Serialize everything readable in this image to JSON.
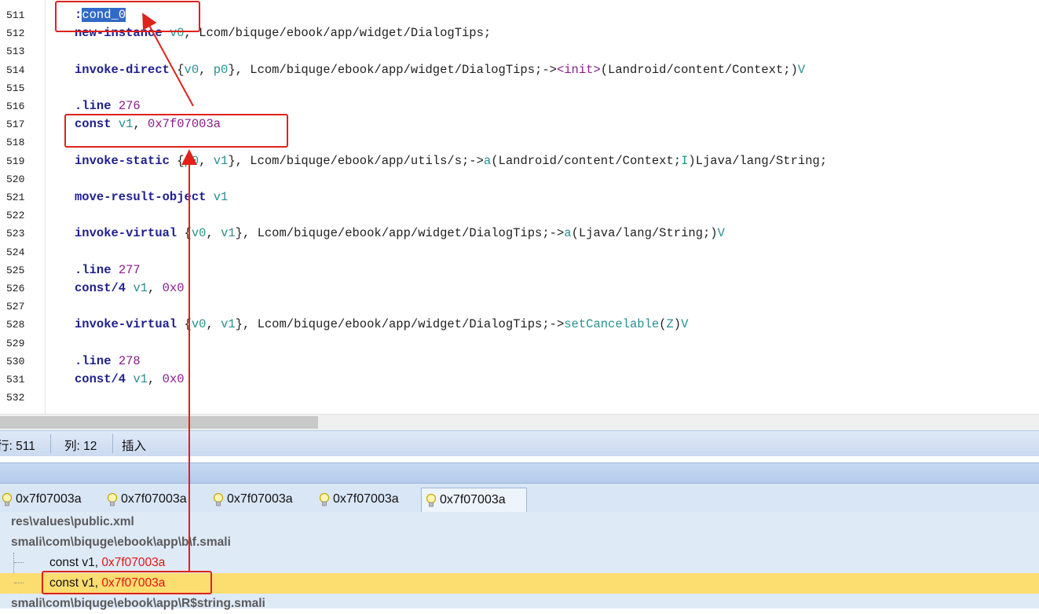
{
  "editor": {
    "lines": [
      {
        "n": "511",
        "label": ":cond_0"
      },
      {
        "n": "512",
        "parts": [
          [
            "kw",
            "new-instance"
          ],
          [
            "tx",
            " "
          ],
          [
            "rg",
            "v0"
          ],
          [
            "tx",
            ", Lcom/biquge/ebook/app/widget/DialogTips;"
          ]
        ]
      },
      {
        "n": "513",
        "parts": []
      },
      {
        "n": "514",
        "parts": [
          [
            "kw",
            "invoke-direct"
          ],
          [
            "tx",
            " {"
          ],
          [
            "rg",
            "v0"
          ],
          [
            "tx",
            ", "
          ],
          [
            "rg",
            "p0"
          ],
          [
            "tx",
            "}, Lcom/biquge/ebook/app/widget/DialogTips;->"
          ],
          [
            "lit",
            "<init>"
          ],
          [
            "tx",
            "(Landroid/content/Context;)"
          ],
          [
            "rg",
            "V"
          ]
        ]
      },
      {
        "n": "515",
        "parts": []
      },
      {
        "n": "516",
        "parts": [
          [
            "kw",
            ".line"
          ],
          [
            "tx",
            " "
          ],
          [
            "lit",
            "276"
          ]
        ]
      },
      {
        "n": "517",
        "parts": [
          [
            "kw",
            "const"
          ],
          [
            "tx",
            " "
          ],
          [
            "rg",
            "v1"
          ],
          [
            "tx",
            ", "
          ],
          [
            "lit",
            "0x7f07003a"
          ]
        ]
      },
      {
        "n": "518",
        "parts": []
      },
      {
        "n": "519",
        "parts": [
          [
            "kw",
            "invoke-static"
          ],
          [
            "tx",
            " {"
          ],
          [
            "rg",
            "p0"
          ],
          [
            "tx",
            ", "
          ],
          [
            "rg",
            "v1"
          ],
          [
            "tx",
            "}, Lcom/biquge/ebook/app/utils/s;->"
          ],
          [
            "rg",
            "a"
          ],
          [
            "tx",
            "(Landroid/content/Context;"
          ],
          [
            "rg",
            "I"
          ],
          [
            "tx",
            ")Ljava/lang/String;"
          ]
        ]
      },
      {
        "n": "520",
        "parts": []
      },
      {
        "n": "521",
        "parts": [
          [
            "kw",
            "move-result-object"
          ],
          [
            "tx",
            " "
          ],
          [
            "rg",
            "v1"
          ]
        ]
      },
      {
        "n": "522",
        "parts": []
      },
      {
        "n": "523",
        "parts": [
          [
            "kw",
            "invoke-virtual"
          ],
          [
            "tx",
            " {"
          ],
          [
            "rg",
            "v0"
          ],
          [
            "tx",
            ", "
          ],
          [
            "rg",
            "v1"
          ],
          [
            "tx",
            "}, Lcom/biquge/ebook/app/widget/DialogTips;->"
          ],
          [
            "rg",
            "a"
          ],
          [
            "tx",
            "(Ljava/lang/String;)"
          ],
          [
            "rg",
            "V"
          ]
        ]
      },
      {
        "n": "524",
        "parts": []
      },
      {
        "n": "525",
        "parts": [
          [
            "kw",
            ".line"
          ],
          [
            "tx",
            " "
          ],
          [
            "lit",
            "277"
          ]
        ]
      },
      {
        "n": "526",
        "parts": [
          [
            "kw",
            "const/4"
          ],
          [
            "tx",
            " "
          ],
          [
            "rg",
            "v1"
          ],
          [
            "tx",
            ", "
          ],
          [
            "lit",
            "0x0"
          ]
        ]
      },
      {
        "n": "527",
        "parts": []
      },
      {
        "n": "528",
        "parts": [
          [
            "kw",
            "invoke-virtual"
          ],
          [
            "tx",
            " {"
          ],
          [
            "rg",
            "v0"
          ],
          [
            "tx",
            ", "
          ],
          [
            "rg",
            "v1"
          ],
          [
            "tx",
            "}, Lcom/biquge/ebook/app/widget/DialogTips;->"
          ],
          [
            "rg",
            "setCancelable"
          ],
          [
            "tx",
            "("
          ],
          [
            "rg",
            "Z"
          ],
          [
            "tx",
            ")"
          ],
          [
            "rg",
            "V"
          ]
        ]
      },
      {
        "n": "529",
        "parts": []
      },
      {
        "n": "530",
        "parts": [
          [
            "kw",
            ".line"
          ],
          [
            "tx",
            " "
          ],
          [
            "lit",
            "278"
          ]
        ]
      },
      {
        "n": "531",
        "parts": [
          [
            "kw",
            "const/4"
          ],
          [
            "tx",
            " "
          ],
          [
            "rg",
            "v1"
          ],
          [
            "tx",
            ", "
          ],
          [
            "lit",
            "0x0"
          ]
        ]
      },
      {
        "n": "532",
        "parts": []
      }
    ]
  },
  "status": {
    "row": "行: 511",
    "col": "列: 12",
    "mode": "插入"
  },
  "tabs": [
    "0x7f07003a",
    "0x7f07003a",
    "0x7f07003a",
    "0x7f07003a",
    "0x7f07003a"
  ],
  "results": {
    "file1": "res\\values\\public.xml",
    "file2": "smali\\com\\biquge\\ebook\\app\\b\\f.smali",
    "match1_prefix": "const v1, ",
    "match1_value": "0x7f07003a",
    "match2_prefix": "const v1, ",
    "match2_value": "0x7f07003a",
    "file3": "smali\\com\\biquge\\ebook\\app\\R$string.smali"
  },
  "colors": {
    "keyword": "#1f1f8f",
    "register": "#2a8f8f",
    "literal": "#8b1c8b",
    "annotation": "#e0221a",
    "highlight_row": "#fbdd70"
  }
}
